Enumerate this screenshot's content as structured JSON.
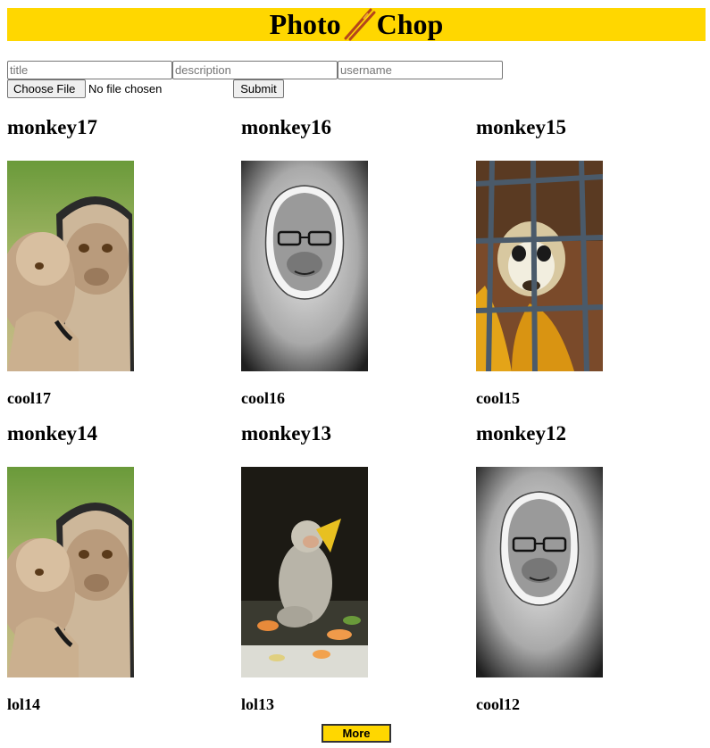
{
  "header": {
    "title_left": "Photo",
    "title_right": "Chop",
    "logo_icon": "chopsticks-icon",
    "banner_color": "#ffd700"
  },
  "upload_form": {
    "title_placeholder": "title",
    "description_placeholder": "description",
    "username_placeholder": "username",
    "file_button_label": "Choose File",
    "file_status": "No file chosen",
    "submit_label": "Submit"
  },
  "posts": [
    {
      "title": "monkey17",
      "description": "cool17",
      "image": "monkeys-mirror"
    },
    {
      "title": "monkey16",
      "description": "cool16",
      "image": "gorilla-sketch"
    },
    {
      "title": "monkey15",
      "description": "cool15",
      "image": "squirrel-monkey-cage"
    },
    {
      "title": "monkey14",
      "description": "lol14",
      "image": "monkeys-mirror"
    },
    {
      "title": "monkey13",
      "description": "lol13",
      "image": "macaque-eating-papaya"
    },
    {
      "title": "monkey12",
      "description": "cool12",
      "image": "gorilla-sketch"
    }
  ],
  "pagination": {
    "more_label": "More"
  }
}
